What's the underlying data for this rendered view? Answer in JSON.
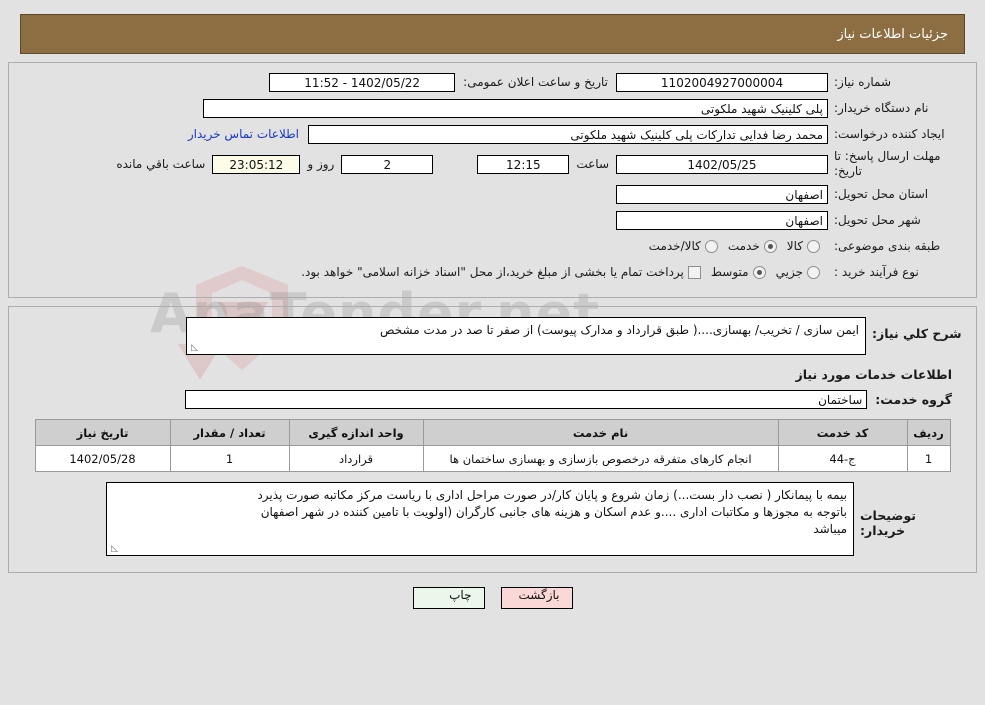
{
  "header": {
    "title": "جزئیات اطلاعات نیاز",
    "bar_color": "#8d6e42"
  },
  "watermark": {
    "text": "AnaTender.net"
  },
  "form": {
    "need_number": {
      "label": "شماره نیاز:",
      "value": "1102004927000004"
    },
    "public_announce": {
      "label": "تاریخ و ساعت اعلان عمومی:",
      "value": "1402/05/22 - 11:52"
    },
    "buyer_org": {
      "label": "نام دستگاه خریدار:",
      "value": "پلی کلینیک شهید ملکوتی"
    },
    "creator": {
      "label": "ایجاد کننده درخواست:",
      "value": "محمد رضا  فدایی تدارکات پلی کلینیک شهید ملکوتی"
    },
    "contact_link": "اطلاعات تماس خریدار",
    "deadline": {
      "label": "مهلت ارسال پاسخ: تا تاریخ:",
      "date": "1402/05/25",
      "time_label": "ساعت",
      "time": "12:15",
      "days": "2",
      "days_unit": "روز و",
      "clock": "23:05:12",
      "remaining_label": "ساعت باقي مانده"
    },
    "province": {
      "label": "استان محل تحویل:",
      "value": "اصفهان"
    },
    "city": {
      "label": "شهر محل تحویل:",
      "value": "اصفهان"
    },
    "classification": {
      "label": "طبقه بندی موضوعی:",
      "options": [
        {
          "text": "کالا",
          "selected": false
        },
        {
          "text": "خدمت",
          "selected": true
        },
        {
          "text": "کالا/خدمت",
          "selected": false
        }
      ]
    },
    "process_type": {
      "label": "نوع فرآیند خرید :",
      "options": [
        {
          "text": "جزیي",
          "selected": false
        },
        {
          "text": "متوسط",
          "selected": true
        }
      ],
      "checkbox": {
        "text": "پرداخت تمام یا بخشی از مبلغ خرید،از محل \"اسناد خزانه اسلامی\" خواهد بود.",
        "checked": false
      }
    }
  },
  "description": {
    "label": "شرح کلي نیاز:",
    "value": "ایمن سازی / تخریب/ بهسازی....( طبق قرارداد و مدارک پیوست) از صفر تا صد در  مدت مشخص"
  },
  "services": {
    "section_title": "اطلاعات خدمات مورد نیاز",
    "group_label": "گروه خدمت:",
    "group_value": "ساختمان",
    "table": {
      "columns": [
        "ردیف",
        "کد خدمت",
        "نام خدمت",
        "واحد اندازه گیری",
        "تعداد / مقدار",
        "تاریخ نیاز"
      ],
      "rows": [
        {
          "row": "1",
          "code": "ج-44",
          "name": "انجام کارهای متفرقه درخصوص بازسازی و بهسازی ساختمان ها",
          "unit": "قرارداد",
          "qty": "1",
          "date": "1402/05/28"
        }
      ]
    }
  },
  "notes": {
    "label": "توضیحات خریدار:",
    "line1": "بیمه با پیمانکار ( نصب دار بست...)  زمان شروع و پایان کار/در صورت مراحل اداری با ریاست مرکز مکاتبه  صورت پذیرد",
    "line2": "باتوجه به مجوزها و مکاتبات اداری ....و  عدم اسکان و هزینه های جانبی کارگران   (اولویت با تامین کننده در شهر اصفهان",
    "line3": "میباشد"
  },
  "footer": {
    "print": "چاپ",
    "back": "بازگشت"
  }
}
